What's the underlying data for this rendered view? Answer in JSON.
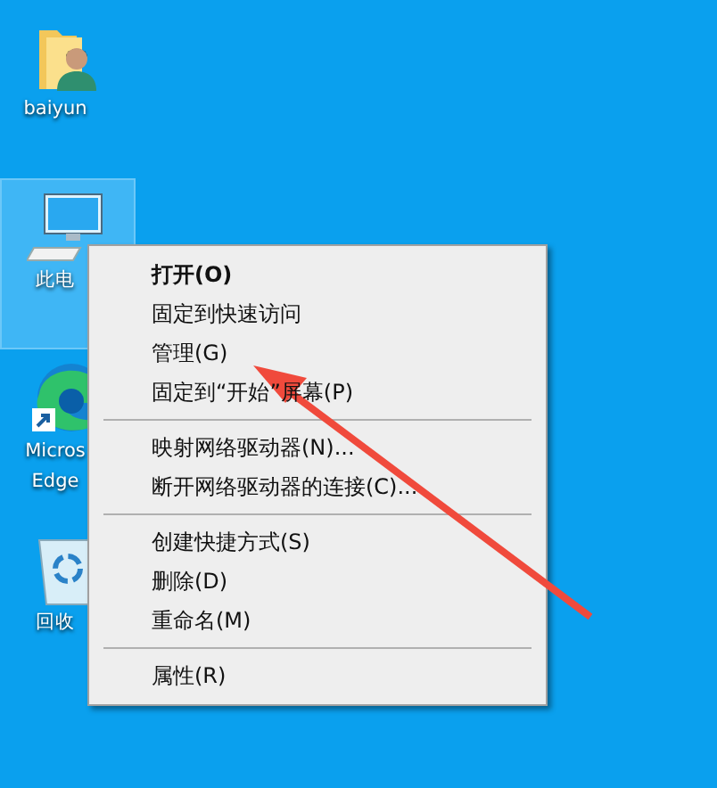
{
  "desktop_icons": [
    {
      "kind": "user-folder",
      "labels": [
        "baiyun"
      ],
      "selected": false
    },
    {
      "kind": "computer",
      "labels": [
        "此电"
      ],
      "selected": true
    },
    {
      "kind": "edge",
      "labels": [
        "Micros",
        "Edge"
      ],
      "selected": false
    },
    {
      "kind": "recycle-bin",
      "labels": [
        "回收"
      ],
      "selected": false
    }
  ],
  "context_menu": {
    "groups": [
      [
        {
          "label": "打开(O)",
          "default": true
        },
        {
          "label": "固定到快速访问",
          "default": false
        },
        {
          "label": "管理(G)",
          "default": false
        },
        {
          "label": "固定到“开始”屏幕(P)",
          "default": false
        }
      ],
      [
        {
          "label": "映射网络驱动器(N)...",
          "default": false
        },
        {
          "label": "断开网络驱动器的连接(C)...",
          "default": false
        }
      ],
      [
        {
          "label": "创建快捷方式(S)",
          "default": false
        },
        {
          "label": "删除(D)",
          "default": false
        },
        {
          "label": "重命名(M)",
          "default": false
        }
      ],
      [
        {
          "label": "属性(R)",
          "default": false
        }
      ]
    ]
  }
}
